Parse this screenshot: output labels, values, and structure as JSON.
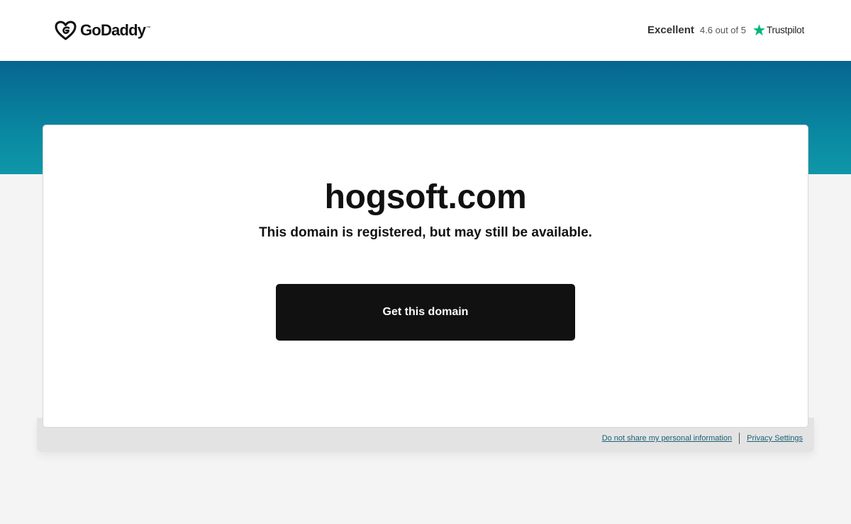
{
  "header": {
    "logo_text": "GoDaddy",
    "logo_tm": "™",
    "trustpilot": {
      "rating_word": "Excellent",
      "score_text": "4.6 out of 5",
      "brand": "Trustpilot",
      "star_icon": "star-icon",
      "star_color": "#00b67a"
    }
  },
  "main": {
    "domain": "hogsoft.com",
    "subtitle": "This domain is registered, but may still be available.",
    "cta_label": "Get this domain"
  },
  "footer": {
    "links": [
      {
        "label": "Do not share my personal information"
      },
      {
        "label": "Privacy Settings"
      }
    ]
  },
  "colors": {
    "hero_top": "#06668f",
    "hero_bottom": "#0f97a8",
    "cta_background": "#111111",
    "link": "#1c5f73"
  }
}
